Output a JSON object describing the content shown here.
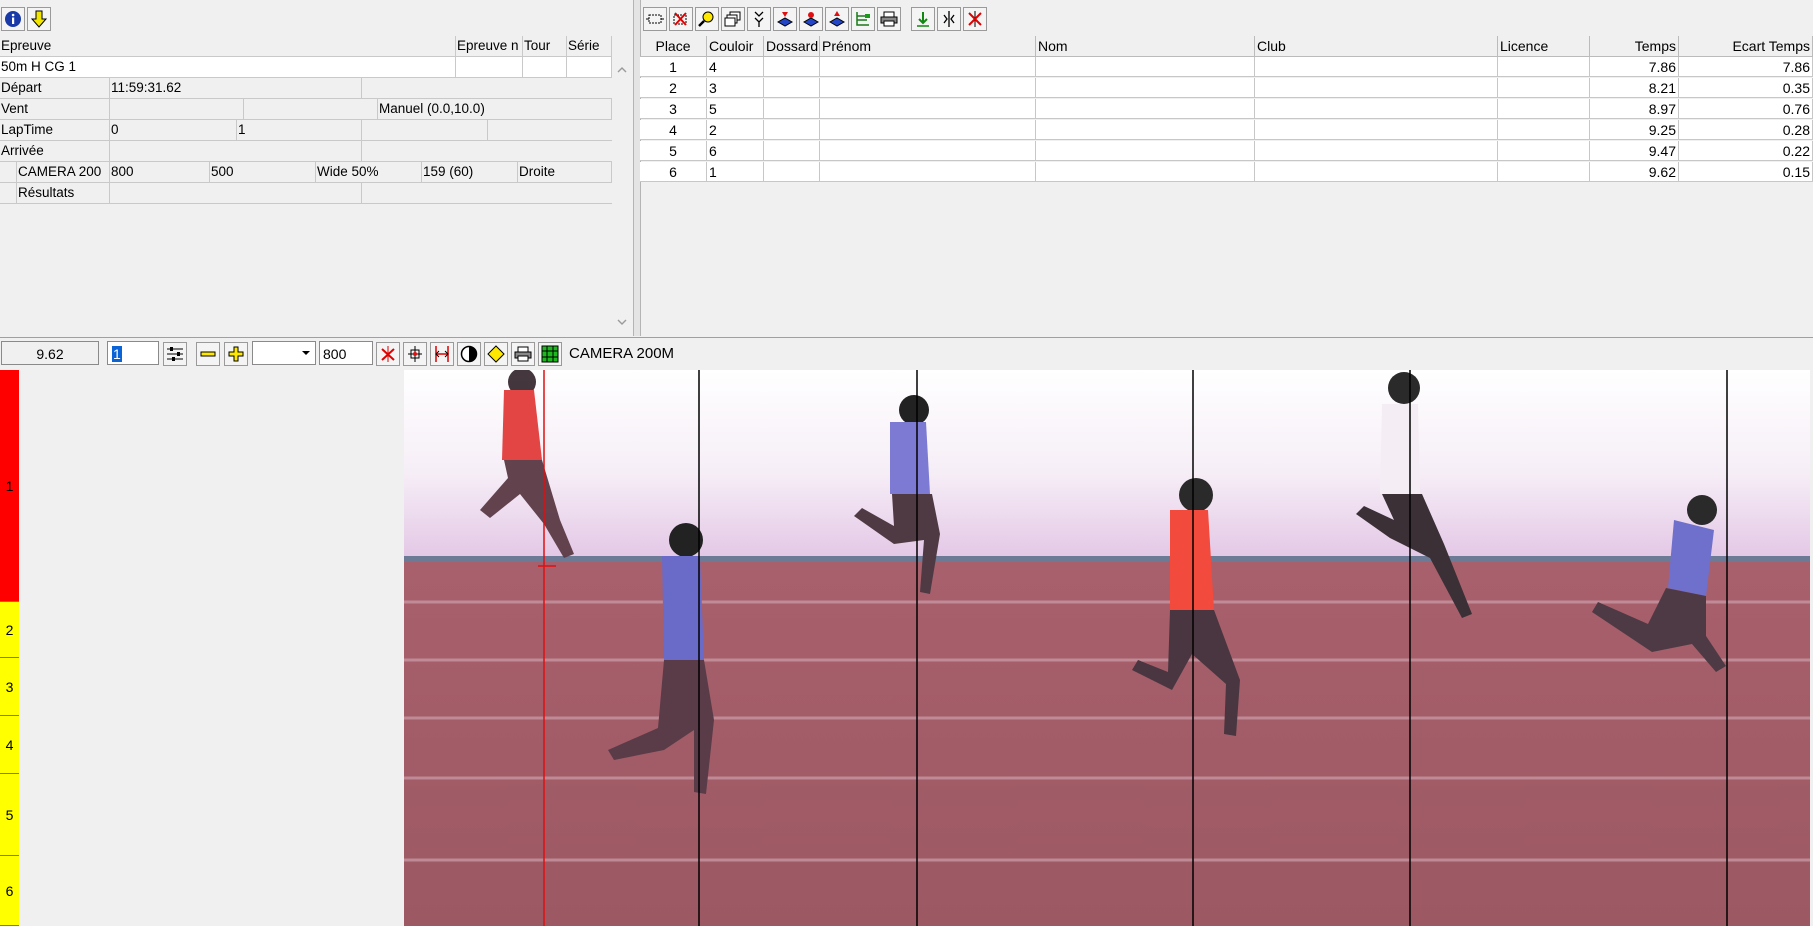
{
  "info_toolbar": {
    "info_icon": "info-icon",
    "down_icon": "down-arrow-icon"
  },
  "info": {
    "headers": {
      "epreuve": "Epreuve",
      "epreuve_n": "Epreuve n",
      "tour": "Tour",
      "serie": "Série"
    },
    "event_name": "50m H CG 1",
    "depart_label": "Départ",
    "depart_value": "11:59:31.62",
    "vent_label": "Vent",
    "vent_value": "Manuel (0.0,10.0)",
    "laptime_label": "LapTime",
    "laptime_v1": "0",
    "laptime_v2": "1",
    "arrivee_label": "Arrivée",
    "camera_name": "CAMERA 200",
    "camera_v1": "800",
    "camera_v2": "500",
    "camera_wide": "Wide 50%",
    "camera_frames": "159  (60)",
    "camera_side": "Droite",
    "resultats_label": "Résultats"
  },
  "results": {
    "columns": [
      "Place",
      "Couloir",
      "Dossard",
      "Prénom",
      "Nom",
      "Club",
      "Licence",
      "Temps",
      "Ecart Temps"
    ],
    "rows": [
      {
        "place": "1",
        "couloir": "4",
        "temps": "7.86",
        "ecart": "7.86"
      },
      {
        "place": "2",
        "couloir": "3",
        "temps": "8.21",
        "ecart": "0.35"
      },
      {
        "place": "3",
        "couloir": "5",
        "temps": "8.97",
        "ecart": "0.76"
      },
      {
        "place": "4",
        "couloir": "2",
        "temps": "9.25",
        "ecart": "0.28"
      },
      {
        "place": "5",
        "couloir": "6",
        "temps": "9.47",
        "ecart": "0.22"
      },
      {
        "place": "6",
        "couloir": "1",
        "temps": "9.62",
        "ecart": "0.15"
      }
    ]
  },
  "viewer": {
    "time_value": "9.62",
    "frame_value": "1",
    "zoom_value": "800",
    "camera_label": "CAMERA 200M",
    "lanes": [
      "1",
      "2",
      "3",
      "4",
      "5",
      "6"
    ]
  },
  "colors": {
    "lane_active": "#ff0000",
    "lane": "#ffff00",
    "cursor": "#e01010",
    "track": "#a45a66"
  }
}
